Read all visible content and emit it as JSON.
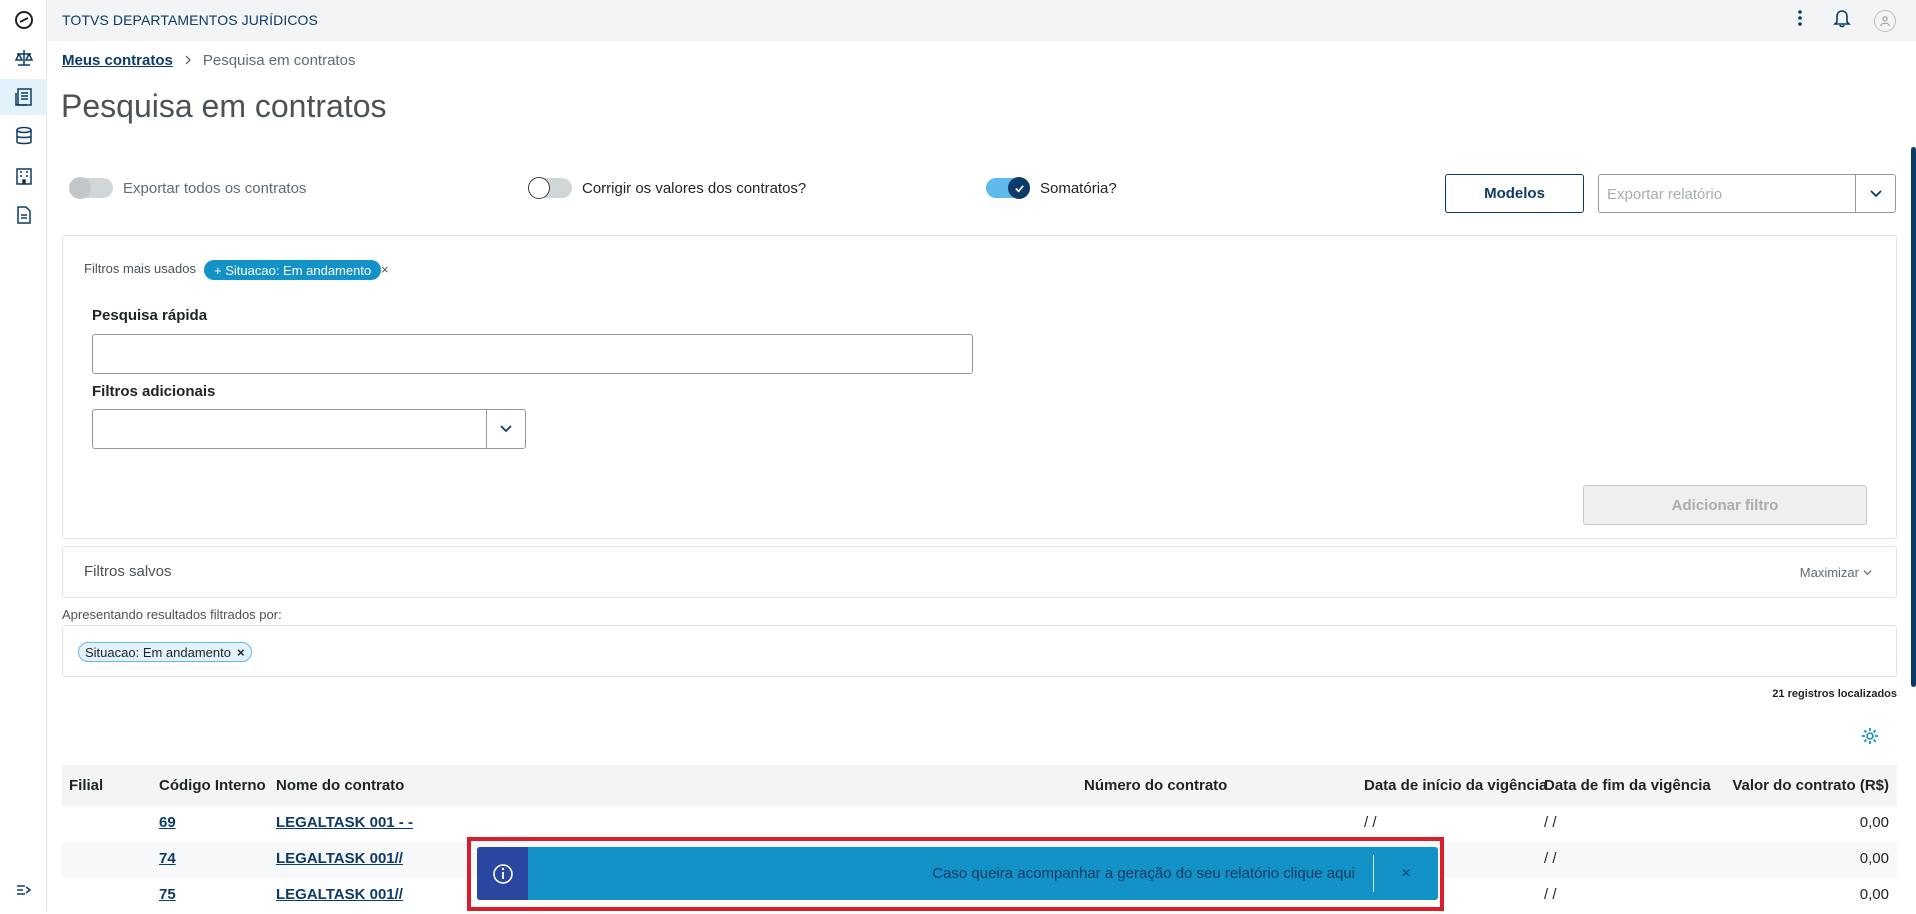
{
  "header": {
    "app_title": "TOTVS DEPARTAMENTOS JURÍDICOS"
  },
  "sidebar": {
    "items": [
      {
        "icon": "totvs-logo-icon"
      },
      {
        "icon": "scale-icon"
      },
      {
        "icon": "contracts-icon",
        "active": true
      },
      {
        "icon": "database-icon"
      },
      {
        "icon": "building-icon"
      },
      {
        "icon": "document-icon"
      }
    ],
    "footer_icon": "expand-menu-icon"
  },
  "breadcrumb": {
    "parent": "Meus contratos",
    "current": "Pesquisa em contratos"
  },
  "page": {
    "title": "Pesquisa em contratos"
  },
  "toggles": {
    "export_all": {
      "label": "Exportar todos os contratos",
      "on": false
    },
    "correct_values": {
      "label": "Corrigir os valores dos contratos?",
      "on": false
    },
    "sum": {
      "label": "Somatória?",
      "on": true
    }
  },
  "actions": {
    "models_button": "Modelos",
    "export_placeholder": "Exportar relatório"
  },
  "filters": {
    "most_used_label": "Filtros mais usados",
    "chip_label": "+ Situacao: Em andamento",
    "chip_close": "×",
    "quick_search_label": "Pesquisa rápida",
    "quick_search_value": "",
    "additional_label": "Filtros adicionais",
    "additional_value": "",
    "add_filter_button": "Adicionar filtro"
  },
  "saved_filters": {
    "title": "Filtros salvos",
    "maximize": "Maximizar"
  },
  "results": {
    "label": "Apresentando resultados filtrados por:",
    "active_chip": "Situacao: Em andamento",
    "active_chip_close": "×",
    "count": "21 registros localizados"
  },
  "table": {
    "columns": {
      "filial": "Filial",
      "codigo": "Código Interno",
      "nome": "Nome do contrato",
      "numero": "Número do contrato",
      "inicio": "Data de início da vigência",
      "fim": "Data de fim da vigência",
      "valor": "Valor do contrato (R$)"
    },
    "rows": [
      {
        "filial": "",
        "codigo": "69",
        "nome": "LEGALTASK 001 - -",
        "numero": "",
        "inicio": "/ /",
        "fim": "/ /",
        "valor": "0,00"
      },
      {
        "filial": "",
        "codigo": "74",
        "nome": "LEGALTASK 001//",
        "numero": "",
        "inicio": "",
        "fim": "/ /",
        "valor": "0,00"
      },
      {
        "filial": "",
        "codigo": "75",
        "nome": "LEGALTASK 001//",
        "numero": "",
        "inicio": "",
        "fim": "/ /",
        "valor": "0,00"
      }
    ]
  },
  "toast": {
    "message": "Caso queira acompanhar a geração do seu relatório clique aqui",
    "close": "×",
    "color": "#1392c7",
    "icon": "info-icon"
  },
  "colors": {
    "primary": "#0c3b67",
    "accent": "#1392c7",
    "highlight_border": "#d91e2a"
  }
}
